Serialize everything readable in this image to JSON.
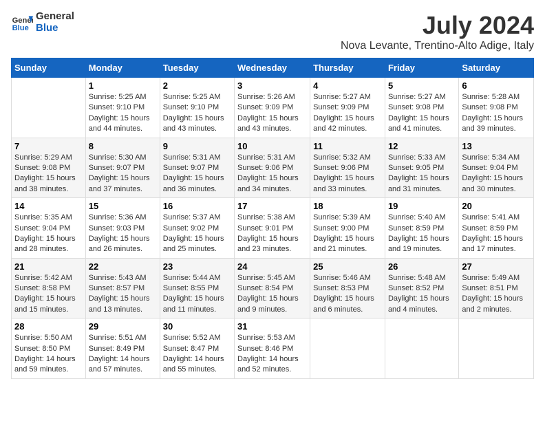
{
  "logo": {
    "line1": "General",
    "line2": "Blue"
  },
  "title": "July 2024",
  "location": "Nova Levante, Trentino-Alto Adige, Italy",
  "days_of_week": [
    "Sunday",
    "Monday",
    "Tuesday",
    "Wednesday",
    "Thursday",
    "Friday",
    "Saturday"
  ],
  "weeks": [
    [
      {
        "day": "",
        "info": ""
      },
      {
        "day": "1",
        "info": "Sunrise: 5:25 AM\nSunset: 9:10 PM\nDaylight: 15 hours\nand 44 minutes."
      },
      {
        "day": "2",
        "info": "Sunrise: 5:25 AM\nSunset: 9:10 PM\nDaylight: 15 hours\nand 43 minutes."
      },
      {
        "day": "3",
        "info": "Sunrise: 5:26 AM\nSunset: 9:09 PM\nDaylight: 15 hours\nand 43 minutes."
      },
      {
        "day": "4",
        "info": "Sunrise: 5:27 AM\nSunset: 9:09 PM\nDaylight: 15 hours\nand 42 minutes."
      },
      {
        "day": "5",
        "info": "Sunrise: 5:27 AM\nSunset: 9:08 PM\nDaylight: 15 hours\nand 41 minutes."
      },
      {
        "day": "6",
        "info": "Sunrise: 5:28 AM\nSunset: 9:08 PM\nDaylight: 15 hours\nand 39 minutes."
      }
    ],
    [
      {
        "day": "7",
        "info": "Sunrise: 5:29 AM\nSunset: 9:08 PM\nDaylight: 15 hours\nand 38 minutes."
      },
      {
        "day": "8",
        "info": "Sunrise: 5:30 AM\nSunset: 9:07 PM\nDaylight: 15 hours\nand 37 minutes."
      },
      {
        "day": "9",
        "info": "Sunrise: 5:31 AM\nSunset: 9:07 PM\nDaylight: 15 hours\nand 36 minutes."
      },
      {
        "day": "10",
        "info": "Sunrise: 5:31 AM\nSunset: 9:06 PM\nDaylight: 15 hours\nand 34 minutes."
      },
      {
        "day": "11",
        "info": "Sunrise: 5:32 AM\nSunset: 9:06 PM\nDaylight: 15 hours\nand 33 minutes."
      },
      {
        "day": "12",
        "info": "Sunrise: 5:33 AM\nSunset: 9:05 PM\nDaylight: 15 hours\nand 31 minutes."
      },
      {
        "day": "13",
        "info": "Sunrise: 5:34 AM\nSunset: 9:04 PM\nDaylight: 15 hours\nand 30 minutes."
      }
    ],
    [
      {
        "day": "14",
        "info": "Sunrise: 5:35 AM\nSunset: 9:04 PM\nDaylight: 15 hours\nand 28 minutes."
      },
      {
        "day": "15",
        "info": "Sunrise: 5:36 AM\nSunset: 9:03 PM\nDaylight: 15 hours\nand 26 minutes."
      },
      {
        "day": "16",
        "info": "Sunrise: 5:37 AM\nSunset: 9:02 PM\nDaylight: 15 hours\nand 25 minutes."
      },
      {
        "day": "17",
        "info": "Sunrise: 5:38 AM\nSunset: 9:01 PM\nDaylight: 15 hours\nand 23 minutes."
      },
      {
        "day": "18",
        "info": "Sunrise: 5:39 AM\nSunset: 9:00 PM\nDaylight: 15 hours\nand 21 minutes."
      },
      {
        "day": "19",
        "info": "Sunrise: 5:40 AM\nSunset: 8:59 PM\nDaylight: 15 hours\nand 19 minutes."
      },
      {
        "day": "20",
        "info": "Sunrise: 5:41 AM\nSunset: 8:59 PM\nDaylight: 15 hours\nand 17 minutes."
      }
    ],
    [
      {
        "day": "21",
        "info": "Sunrise: 5:42 AM\nSunset: 8:58 PM\nDaylight: 15 hours\nand 15 minutes."
      },
      {
        "day": "22",
        "info": "Sunrise: 5:43 AM\nSunset: 8:57 PM\nDaylight: 15 hours\nand 13 minutes."
      },
      {
        "day": "23",
        "info": "Sunrise: 5:44 AM\nSunset: 8:55 PM\nDaylight: 15 hours\nand 11 minutes."
      },
      {
        "day": "24",
        "info": "Sunrise: 5:45 AM\nSunset: 8:54 PM\nDaylight: 15 hours\nand 9 minutes."
      },
      {
        "day": "25",
        "info": "Sunrise: 5:46 AM\nSunset: 8:53 PM\nDaylight: 15 hours\nand 6 minutes."
      },
      {
        "day": "26",
        "info": "Sunrise: 5:48 AM\nSunset: 8:52 PM\nDaylight: 15 hours\nand 4 minutes."
      },
      {
        "day": "27",
        "info": "Sunrise: 5:49 AM\nSunset: 8:51 PM\nDaylight: 15 hours\nand 2 minutes."
      }
    ],
    [
      {
        "day": "28",
        "info": "Sunrise: 5:50 AM\nSunset: 8:50 PM\nDaylight: 14 hours\nand 59 minutes."
      },
      {
        "day": "29",
        "info": "Sunrise: 5:51 AM\nSunset: 8:49 PM\nDaylight: 14 hours\nand 57 minutes."
      },
      {
        "day": "30",
        "info": "Sunrise: 5:52 AM\nSunset: 8:47 PM\nDaylight: 14 hours\nand 55 minutes."
      },
      {
        "day": "31",
        "info": "Sunrise: 5:53 AM\nSunset: 8:46 PM\nDaylight: 14 hours\nand 52 minutes."
      },
      {
        "day": "",
        "info": ""
      },
      {
        "day": "",
        "info": ""
      },
      {
        "day": "",
        "info": ""
      }
    ]
  ]
}
